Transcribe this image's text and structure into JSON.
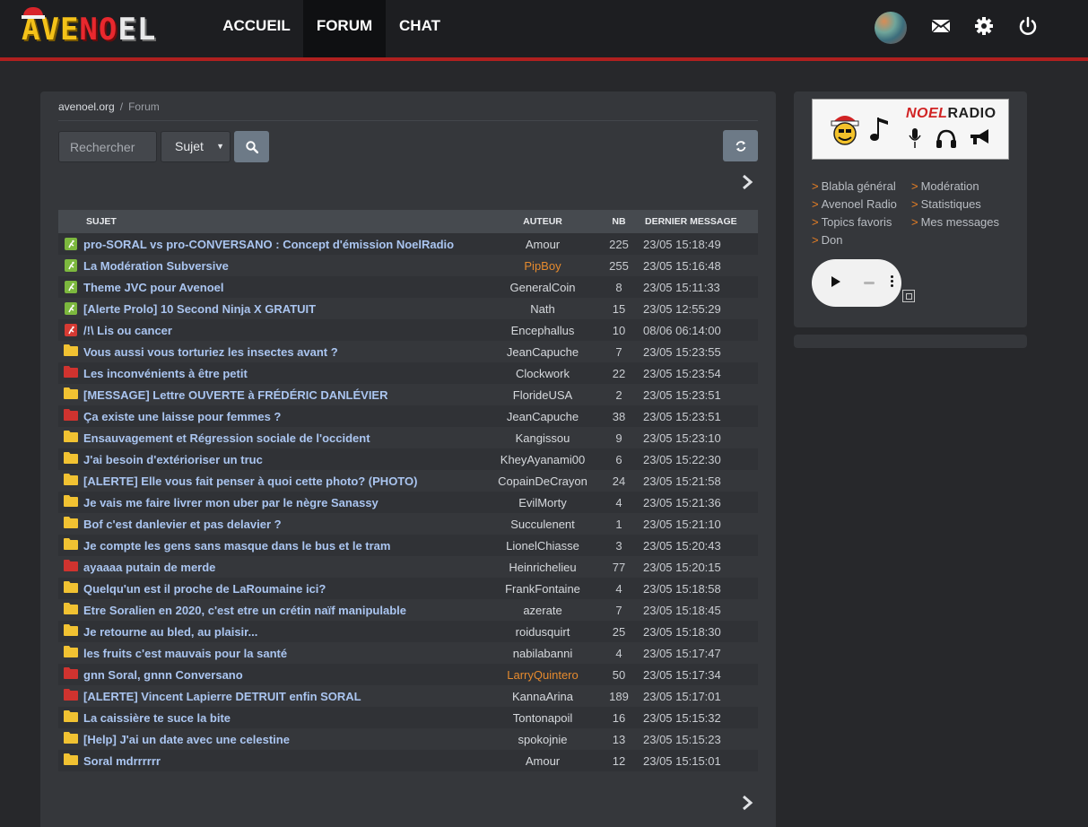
{
  "nav": {
    "logo": "AVENOEL",
    "items": [
      {
        "label": "ACCUEIL"
      },
      {
        "label": "FORUM"
      },
      {
        "label": "CHAT"
      }
    ],
    "icons": [
      "avatar",
      "mail-icon",
      "gear-icon",
      "power-icon"
    ]
  },
  "breadcrumb": {
    "home": "avenoel.org",
    "sep": "/",
    "current": "Forum"
  },
  "search": {
    "placeholder": "Rechercher",
    "scope": "Sujet"
  },
  "table": {
    "headers": {
      "subject": "SUJET",
      "author": "AUTEUR",
      "nb": "NB",
      "last": "DERNIER MESSAGE"
    },
    "rows": [
      {
        "icon": "pin-green",
        "subject": "pro-SORAL vs pro-CONVERSANO : Concept d'émission NoelRadio",
        "author": "Amour",
        "nb": "225",
        "last": "23/05 15:18:49"
      },
      {
        "icon": "pin-green",
        "subject": "La Modération Subversive",
        "author": "PipBoy",
        "author_color": "orange",
        "nb": "255",
        "last": "23/05 15:16:48"
      },
      {
        "icon": "pin-green",
        "subject": "Theme JVC pour Avenoel",
        "author": "GeneralCoin",
        "nb": "8",
        "last": "23/05 15:11:33"
      },
      {
        "icon": "pin-green",
        "subject": "[Alerte Prolo] 10 Second Ninja X GRATUIT",
        "author": "Nath",
        "nb": "15",
        "last": "23/05 12:55:29"
      },
      {
        "icon": "pin-red",
        "subject": "/!\\ Lis ou cancer",
        "author": "Encephallus",
        "nb": "10",
        "last": "08/06 06:14:00"
      },
      {
        "icon": "folder-yellow",
        "subject": "Vous aussi vous torturiez les insectes avant ?",
        "author": "JeanCapuche",
        "nb": "7",
        "last": "23/05 15:23:55"
      },
      {
        "icon": "folder-red",
        "subject": "Les inconvénients à être petit",
        "author": "Clockwork",
        "nb": "22",
        "last": "23/05 15:23:54"
      },
      {
        "icon": "folder-yellow",
        "subject": "[MESSAGE] Lettre OUVERTE à FRÉDÉRIC DANLÉVIER",
        "author": "FlorideUSA",
        "nb": "2",
        "last": "23/05 15:23:51"
      },
      {
        "icon": "folder-red",
        "subject": "Ça existe une laisse pour femmes ?",
        "author": "JeanCapuche",
        "nb": "38",
        "last": "23/05 15:23:51"
      },
      {
        "icon": "folder-yellow",
        "subject": "Ensauvagement et Régression sociale de l'occident",
        "author": "Kangissou",
        "nb": "9",
        "last": "23/05 15:23:10"
      },
      {
        "icon": "folder-yellow",
        "subject": "J'ai besoin d'extérioriser un truc",
        "author": "KheyAyanami00",
        "nb": "6",
        "last": "23/05 15:22:30"
      },
      {
        "icon": "folder-yellow",
        "subject": "[ALERTE] Elle vous fait penser à quoi cette photo? (PHOTO)",
        "author": "CopainDeCrayon",
        "nb": "24",
        "last": "23/05 15:21:58"
      },
      {
        "icon": "folder-yellow",
        "subject": "Je vais me faire livrer mon uber par le nègre Sanassy",
        "author": "EvilMorty",
        "nb": "4",
        "last": "23/05 15:21:36"
      },
      {
        "icon": "folder-yellow",
        "subject": "Bof c'est danlevier et pas delavier ?",
        "author": "Succulenent",
        "nb": "1",
        "last": "23/05 15:21:10"
      },
      {
        "icon": "folder-yellow",
        "subject": "Je compte les gens sans masque dans le bus et le tram",
        "author": "LionelChiasse",
        "nb": "3",
        "last": "23/05 15:20:43"
      },
      {
        "icon": "folder-red",
        "subject": "ayaaaa putain de merde",
        "author": "Heinrichelieu",
        "nb": "77",
        "last": "23/05 15:20:15"
      },
      {
        "icon": "folder-yellow",
        "subject": "Quelqu'un est il proche de LaRoumaine ici?",
        "author": "FrankFontaine",
        "nb": "4",
        "last": "23/05 15:18:58"
      },
      {
        "icon": "folder-yellow",
        "subject": "Etre Soralien en 2020, c'est etre un crétin naïf manipulable",
        "author": "azerate",
        "nb": "7",
        "last": "23/05 15:18:45"
      },
      {
        "icon": "folder-yellow",
        "subject": "Je retourne au bled, au plaisir...",
        "author": "roidusquirt",
        "nb": "25",
        "last": "23/05 15:18:30"
      },
      {
        "icon": "folder-yellow",
        "subject": "les fruits c'est mauvais pour la santé",
        "author": "nabilabanni",
        "nb": "4",
        "last": "23/05 15:17:47"
      },
      {
        "icon": "folder-red",
        "subject": "gnn Soral, gnnn Conversano",
        "author": "LarryQuintero",
        "author_color": "orange",
        "nb": "50",
        "last": "23/05 15:17:34"
      },
      {
        "icon": "folder-red",
        "subject": "[ALERTE] Vincent Lapierre DETRUIT enfin SORAL",
        "author": "KannaArina",
        "nb": "189",
        "last": "23/05 15:17:01"
      },
      {
        "icon": "folder-yellow",
        "subject": "La caissière te suce la bite",
        "author": "Tontonapoil",
        "nb": "16",
        "last": "23/05 15:15:32"
      },
      {
        "icon": "folder-yellow",
        "subject": "[Help] J'ai un date avec une celestine",
        "author": "spokojnie",
        "nb": "13",
        "last": "23/05 15:15:23"
      },
      {
        "icon": "folder-yellow",
        "subject": "Soral mdrrrrrr",
        "author": "Amour",
        "nb": "12",
        "last": "23/05 15:15:01"
      }
    ]
  },
  "sidebar": {
    "radio": {
      "noel": "NOEL",
      "radio": "RADIO"
    },
    "links": [
      {
        "label": "Blabla général"
      },
      {
        "label": "Modération"
      },
      {
        "label": "Avenoel Radio"
      },
      {
        "label": "Statistiques"
      },
      {
        "label": "Topics favoris"
      },
      {
        "label": "Mes messages"
      },
      {
        "label": "Don"
      }
    ],
    "link_marker": ">"
  },
  "colors": {
    "accent_red": "#b0201f",
    "link_blue": "#aac5f0",
    "orange_user": "#e58a2e",
    "pin_green": "#7cb83e",
    "pin_red": "#d53a33",
    "folder_yellow": "#f1c232",
    "folder_red": "#d0332f"
  }
}
